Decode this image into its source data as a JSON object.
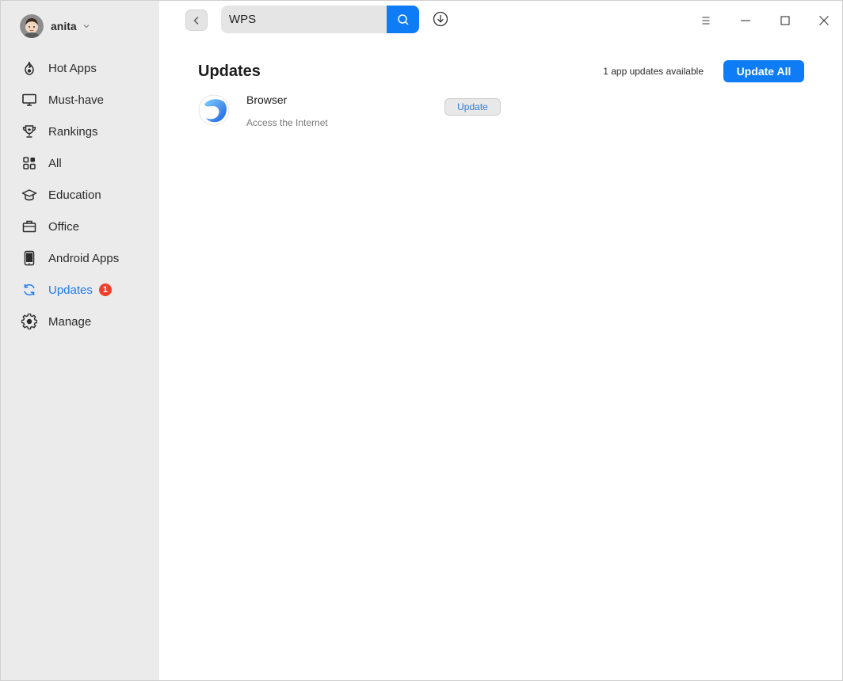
{
  "user": {
    "name": "anita"
  },
  "sidebar": {
    "items": [
      {
        "label": "Hot Apps",
        "icon": "flame-icon"
      },
      {
        "label": "Must-have",
        "icon": "monitor-icon"
      },
      {
        "label": "Rankings",
        "icon": "trophy-icon"
      },
      {
        "label": "All",
        "icon": "grid-icon"
      },
      {
        "label": "Education",
        "icon": "graduation-cap-icon"
      },
      {
        "label": "Office",
        "icon": "briefcase-icon"
      },
      {
        "label": "Android Apps",
        "icon": "phone-icon"
      },
      {
        "label": "Updates",
        "icon": "refresh-icon",
        "active": true,
        "badge": "1"
      },
      {
        "label": "Manage",
        "icon": "gear-icon"
      }
    ]
  },
  "search": {
    "value": "WPS"
  },
  "main": {
    "title": "Updates",
    "updates_count_text": "1 app updates available",
    "update_all_label": "Update All",
    "apps": [
      {
        "name": "Browser",
        "description": "Access the Internet",
        "action_label": "Update"
      }
    ]
  },
  "colors": {
    "accent": "#0e7cf5",
    "active_nav": "#1f7bf0",
    "badge": "#f0402c",
    "sidebar_bg": "#ebebeb"
  }
}
